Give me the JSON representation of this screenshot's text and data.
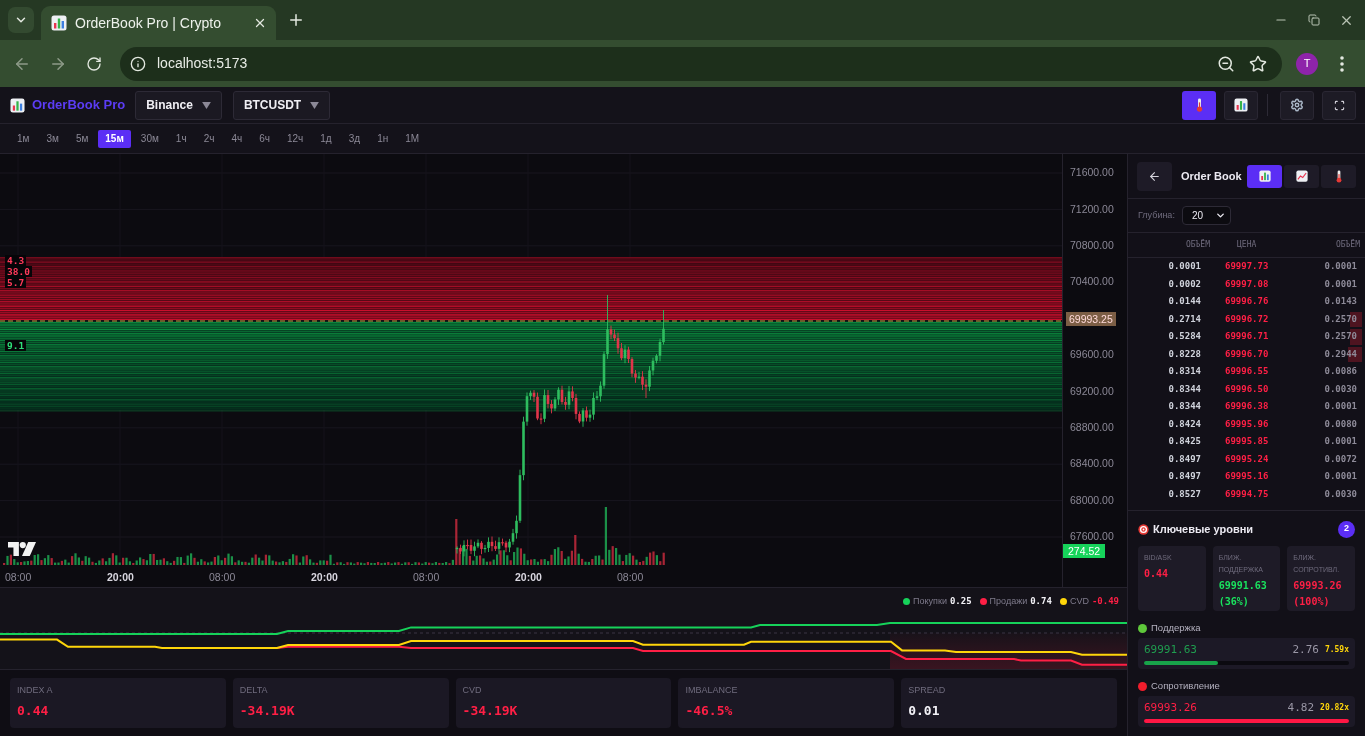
{
  "browser": {
    "tab_title": "OrderBook Pro | Crypto",
    "url": "localhost:5173",
    "profile_initial": "T"
  },
  "header": {
    "app_name": "OrderBook Pro",
    "exchange": "Binance",
    "symbol": "BTCUSDT",
    "tools": [
      {
        "kind": "heatmap",
        "selected": true
      },
      {
        "kind": "chart",
        "selected": false
      },
      {
        "kind": "settings",
        "selected": false
      },
      {
        "kind": "fullscreen",
        "selected": false
      }
    ]
  },
  "timeframes": [
    {
      "label": "1м",
      "selected": false
    },
    {
      "label": "3м",
      "selected": false
    },
    {
      "label": "5м",
      "selected": false
    },
    {
      "label": "15м",
      "selected": true
    },
    {
      "label": "30м",
      "selected": false
    },
    {
      "label": "1ч",
      "selected": false
    },
    {
      "label": "2ч",
      "selected": false
    },
    {
      "label": "4ч",
      "selected": false
    },
    {
      "label": "6ч",
      "selected": false
    },
    {
      "label": "12ч",
      "selected": false
    },
    {
      "label": "1д",
      "selected": false
    },
    {
      "label": "3д",
      "selected": false
    },
    {
      "label": "1н",
      "selected": false
    },
    {
      "label": "1М",
      "selected": false
    }
  ],
  "chart": {
    "level_labels": [
      {
        "label": "4.3",
        "kind": "ask"
      },
      {
        "label": "38.0",
        "kind": "ask"
      },
      {
        "label": "5.7",
        "kind": "ask"
      },
      {
        "label": "9.1",
        "kind": "bid"
      }
    ],
    "price_axis": [
      {
        "label": "71600.00",
        "kind": "tick"
      },
      {
        "label": "71200.00",
        "kind": "tick"
      },
      {
        "label": "70800.00",
        "kind": "tick"
      },
      {
        "label": "70400.00",
        "kind": "tick"
      },
      {
        "label": "69993.25",
        "kind": "current"
      },
      {
        "label": "69600.00",
        "kind": "tick"
      },
      {
        "label": "69200.00",
        "kind": "tick"
      },
      {
        "label": "68800.00",
        "kind": "tick"
      },
      {
        "label": "68400.00",
        "kind": "tick"
      },
      {
        "label": "68000.00",
        "kind": "tick"
      },
      {
        "label": "67600.00",
        "kind": "tick"
      }
    ],
    "volume_tag": "274.52",
    "time_axis": [
      {
        "label": "08:00",
        "major": false
      },
      {
        "label": "20:00",
        "major": true
      },
      {
        "label": "08:00",
        "major": false
      },
      {
        "label": "20:00",
        "major": true
      },
      {
        "label": "08:00",
        "major": false
      },
      {
        "label": "20:00",
        "major": true
      },
      {
        "label": "08:00",
        "major": false
      }
    ]
  },
  "flow": {
    "legend": [
      {
        "label": "Покупки",
        "value": "0.25",
        "color": "#16d25a",
        "kind": "neutral"
      },
      {
        "label": "Продажи",
        "value": "0.74",
        "color": "#ff1f45",
        "kind": "neutral"
      },
      {
        "label": "CVD",
        "value": "-0.49",
        "color": "#ffd60a",
        "kind": "negative"
      }
    ]
  },
  "stats": [
    {
      "label": "INDEX A",
      "value": "0.44",
      "kind": "negative"
    },
    {
      "label": "DELTA",
      "value": "-34.19K",
      "kind": "negative"
    },
    {
      "label": "CVD",
      "value": "-34.19K",
      "kind": "negative"
    },
    {
      "label": "IMBALANCE",
      "value": "-46.5%",
      "kind": "negative"
    },
    {
      "label": "SPREAD",
      "value": "0.01",
      "kind": "neutral"
    }
  ],
  "order_book": {
    "title": "Order Book",
    "views": [
      {
        "kind": "bars",
        "selected": true
      },
      {
        "kind": "line",
        "selected": false
      },
      {
        "kind": "heat",
        "selected": false
      }
    ],
    "depth_label": "Глубина:",
    "depth": "20",
    "columns": [
      "ОБЪЁМ",
      "ЦЕНА",
      "ОБЪЁМ"
    ],
    "rows": [
      {
        "bid_volume": "0.0001",
        "price": "69997.73",
        "ask_volume": "0.0001"
      },
      {
        "bid_volume": "0.0002",
        "price": "69997.08",
        "ask_volume": "0.0001"
      },
      {
        "bid_volume": "0.0144",
        "price": "69996.76",
        "ask_volume": "0.0143"
      },
      {
        "bid_volume": "0.2714",
        "price": "69996.72",
        "ask_volume": "0.2570"
      },
      {
        "bid_volume": "0.5284",
        "price": "69996.71",
        "ask_volume": "0.2570"
      },
      {
        "bid_volume": "0.8228",
        "price": "69996.70",
        "ask_volume": "0.2944"
      },
      {
        "bid_volume": "0.8314",
        "price": "69996.55",
        "ask_volume": "0.0086"
      },
      {
        "bid_volume": "0.8344",
        "price": "69996.50",
        "ask_volume": "0.0030"
      },
      {
        "bid_volume": "0.8344",
        "price": "69996.38",
        "ask_volume": "0.0001"
      },
      {
        "bid_volume": "0.8424",
        "price": "69995.96",
        "ask_volume": "0.0080"
      },
      {
        "bid_volume": "0.8425",
        "price": "69995.85",
        "ask_volume": "0.0001"
      },
      {
        "bid_volume": "0.8497",
        "price": "69995.24",
        "ask_volume": "0.0072"
      },
      {
        "bid_volume": "0.8497",
        "price": "69995.16",
        "ask_volume": "0.0001"
      },
      {
        "bid_volume": "0.8527",
        "price": "69994.75",
        "ask_volume": "0.0030"
      }
    ]
  },
  "key_levels": {
    "title": "Ключевые уровни",
    "count": "2",
    "summary": [
      {
        "label": "BID/ASK",
        "value": "0.44",
        "kind": "negative"
      },
      {
        "label": "БЛИЖ. ПОДДЕРЖКА",
        "value": "69991.63 (36%)",
        "kind": "positive"
      },
      {
        "label": "БЛИЖ. СОПРОТИВЛ.",
        "value": "69993.26 (100%)",
        "kind": "negative"
      }
    ],
    "groups": [
      {
        "title": "Поддержка",
        "color": "#5fc83b",
        "kind": "support",
        "price": "69991.63",
        "volume": "2.76",
        "ratio": "7.59x",
        "level": 0.36
      },
      {
        "title": "Сопротивление",
        "color": "#f01d2c",
        "kind": "resistance",
        "price": "69993.26",
        "volume": "4.82",
        "ratio": "20.82x",
        "level": 1
      }
    ]
  }
}
